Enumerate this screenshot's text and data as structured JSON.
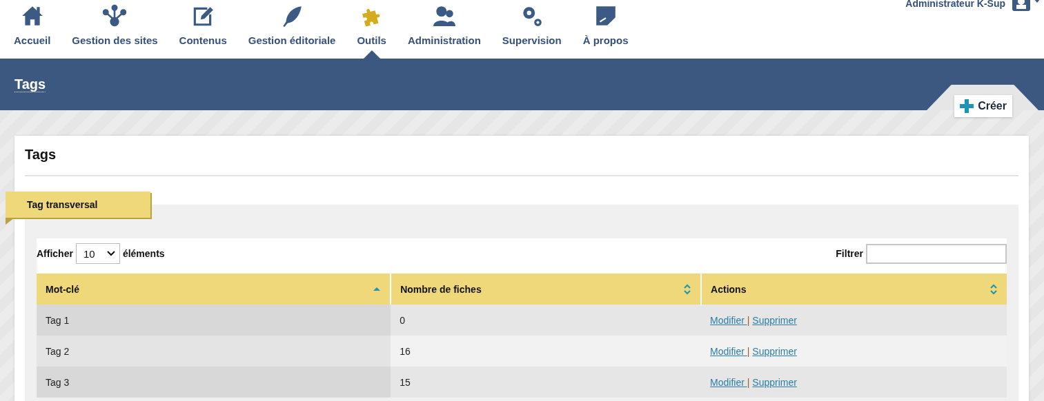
{
  "nav": {
    "items": [
      {
        "label": "Accueil",
        "selected": false
      },
      {
        "label": "Gestion des sites",
        "selected": false
      },
      {
        "label": "Contenus",
        "selected": false
      },
      {
        "label": "Gestion éditoriale",
        "selected": false
      },
      {
        "label": "Outils",
        "selected": true
      },
      {
        "label": "Administration",
        "selected": false
      },
      {
        "label": "Supervision",
        "selected": false
      },
      {
        "label": "À propos",
        "selected": false
      }
    ],
    "user": "Administrateur K-Sup"
  },
  "band": {
    "title": "Tags",
    "create_button": "Créer"
  },
  "card": {
    "title": "Tags",
    "section_tab": "Tag transversal",
    "length": {
      "before": "Afficher",
      "value": "10",
      "after": "éléments"
    },
    "filter": {
      "label": "Filtrer"
    },
    "table": {
      "columns": [
        {
          "label": "Mot-clé",
          "sorted": true
        },
        {
          "label": "Nombre de fiches",
          "sorted": false
        },
        {
          "label": "Actions",
          "sorted": false
        }
      ],
      "rows": [
        {
          "keyword": "Tag 1",
          "count": "0",
          "actions": [
            "Modifier",
            "Supprimer"
          ],
          "separator": "|"
        },
        {
          "keyword": "Tag 2",
          "count": "16",
          "actions": [
            "Modifier",
            "Supprimer"
          ],
          "separator": "|"
        },
        {
          "keyword": "Tag 3",
          "count": "15",
          "actions": [
            "Modifier",
            "Supprimer"
          ],
          "separator": "|"
        }
      ]
    }
  }
}
